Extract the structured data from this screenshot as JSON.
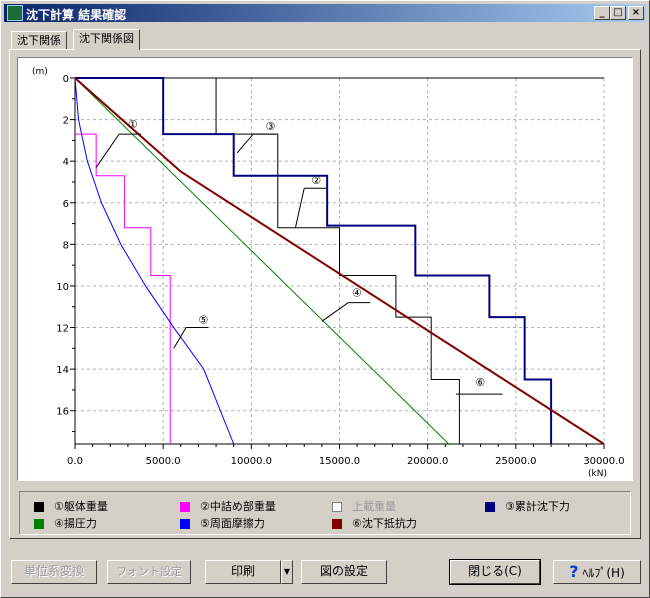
{
  "window": {
    "title": "沈下計算  結果確認"
  },
  "tabs": [
    {
      "label": "沈下関係"
    },
    {
      "label": "沈下関係図"
    }
  ],
  "colors": {
    "c1": "#000000",
    "c2": "#ff00ff",
    "c3": "#000080",
    "c4": "#008000",
    "c5": "#0000ff",
    "c6": "#800000"
  },
  "legend": [
    {
      "label": "①躯体重量",
      "color": "#000000",
      "enabled": true
    },
    {
      "label": "②中詰め部重量",
      "color": "#ff00ff",
      "enabled": true
    },
    {
      "label": "上載重量",
      "color": "#ffffff",
      "enabled": false
    },
    {
      "label": "③累計沈下力",
      "color": "#000080",
      "enabled": true
    },
    {
      "label": "④揚圧力",
      "color": "#008000",
      "enabled": true
    },
    {
      "label": "⑤周面摩擦力",
      "color": "#0000ff",
      "enabled": true
    },
    {
      "label": "⑥沈下抵抗力",
      "color": "#800000",
      "enabled": true
    }
  ],
  "buttons": {
    "unit": "単位系変換",
    "font": "フォント設定",
    "print": "印刷",
    "figure": "図の設定",
    "close": "閉じる(C)",
    "help": "ﾍﾙﾌﾟ(H)"
  },
  "chart_data": {
    "type": "line",
    "xlabel": "(kN)",
    "ylabel": "(m)",
    "xlim": [
      0,
      30000
    ],
    "ylim": [
      0,
      17.6
    ],
    "x_ticks": [
      "0.0",
      "5000.0",
      "10000.0",
      "15000.0",
      "20000.0",
      "25000.0",
      "30000.0"
    ],
    "y_ticks": [
      "0",
      "2",
      "4",
      "6",
      "8",
      "10",
      "12",
      "14",
      "16"
    ],
    "grid": true,
    "series": [
      {
        "name": "①躯体重量",
        "color": "#000000",
        "x": [
          0,
          8000,
          8000,
          11500,
          11500,
          15000,
          15000,
          18200,
          18200,
          20200,
          20200,
          21800,
          21800
        ],
        "y": [
          0,
          0,
          2.7,
          2.7,
          7.2,
          7.2,
          9.5,
          9.5,
          11.5,
          11.5,
          14.5,
          14.5,
          17.6
        ]
      },
      {
        "name": "②中詰め部重量",
        "color": "#ff00ff",
        "x": [
          0,
          1200,
          1200,
          2800,
          2800,
          4300,
          4300,
          5400,
          5400
        ],
        "y": [
          2.7,
          2.7,
          4.7,
          4.7,
          7.2,
          7.2,
          9.5,
          9.5,
          17.6
        ]
      },
      {
        "name": "③累計沈下力",
        "color": "#000080",
        "x": [
          0,
          5000,
          5000,
          9000,
          9000,
          14300,
          14300,
          19300,
          19300,
          23500,
          23500,
          25500,
          25500,
          27000,
          27000
        ],
        "y": [
          0,
          0,
          2.7,
          2.7,
          4.7,
          4.7,
          7.1,
          7.1,
          9.5,
          9.5,
          11.5,
          11.5,
          14.5,
          14.5,
          17.6
        ]
      },
      {
        "name": "④揚圧力",
        "color": "#008000",
        "x": [
          0,
          21200
        ],
        "y": [
          0,
          17.6
        ]
      },
      {
        "name": "⑤周面摩擦力",
        "color": "#0000ff",
        "x": [
          0,
          200,
          700,
          1500,
          2600,
          4000,
          5600,
          7300,
          9000
        ],
        "y": [
          0,
          2,
          4,
          6,
          8,
          10,
          12,
          14,
          17.6
        ]
      },
      {
        "name": "⑥沈下抵抗力",
        "color": "#800000",
        "x": [
          0,
          6000,
          30000
        ],
        "y": [
          0,
          4.5,
          17.6
        ]
      }
    ],
    "annotations": [
      "①",
      "②",
      "③",
      "④",
      "⑤",
      "⑥"
    ]
  }
}
